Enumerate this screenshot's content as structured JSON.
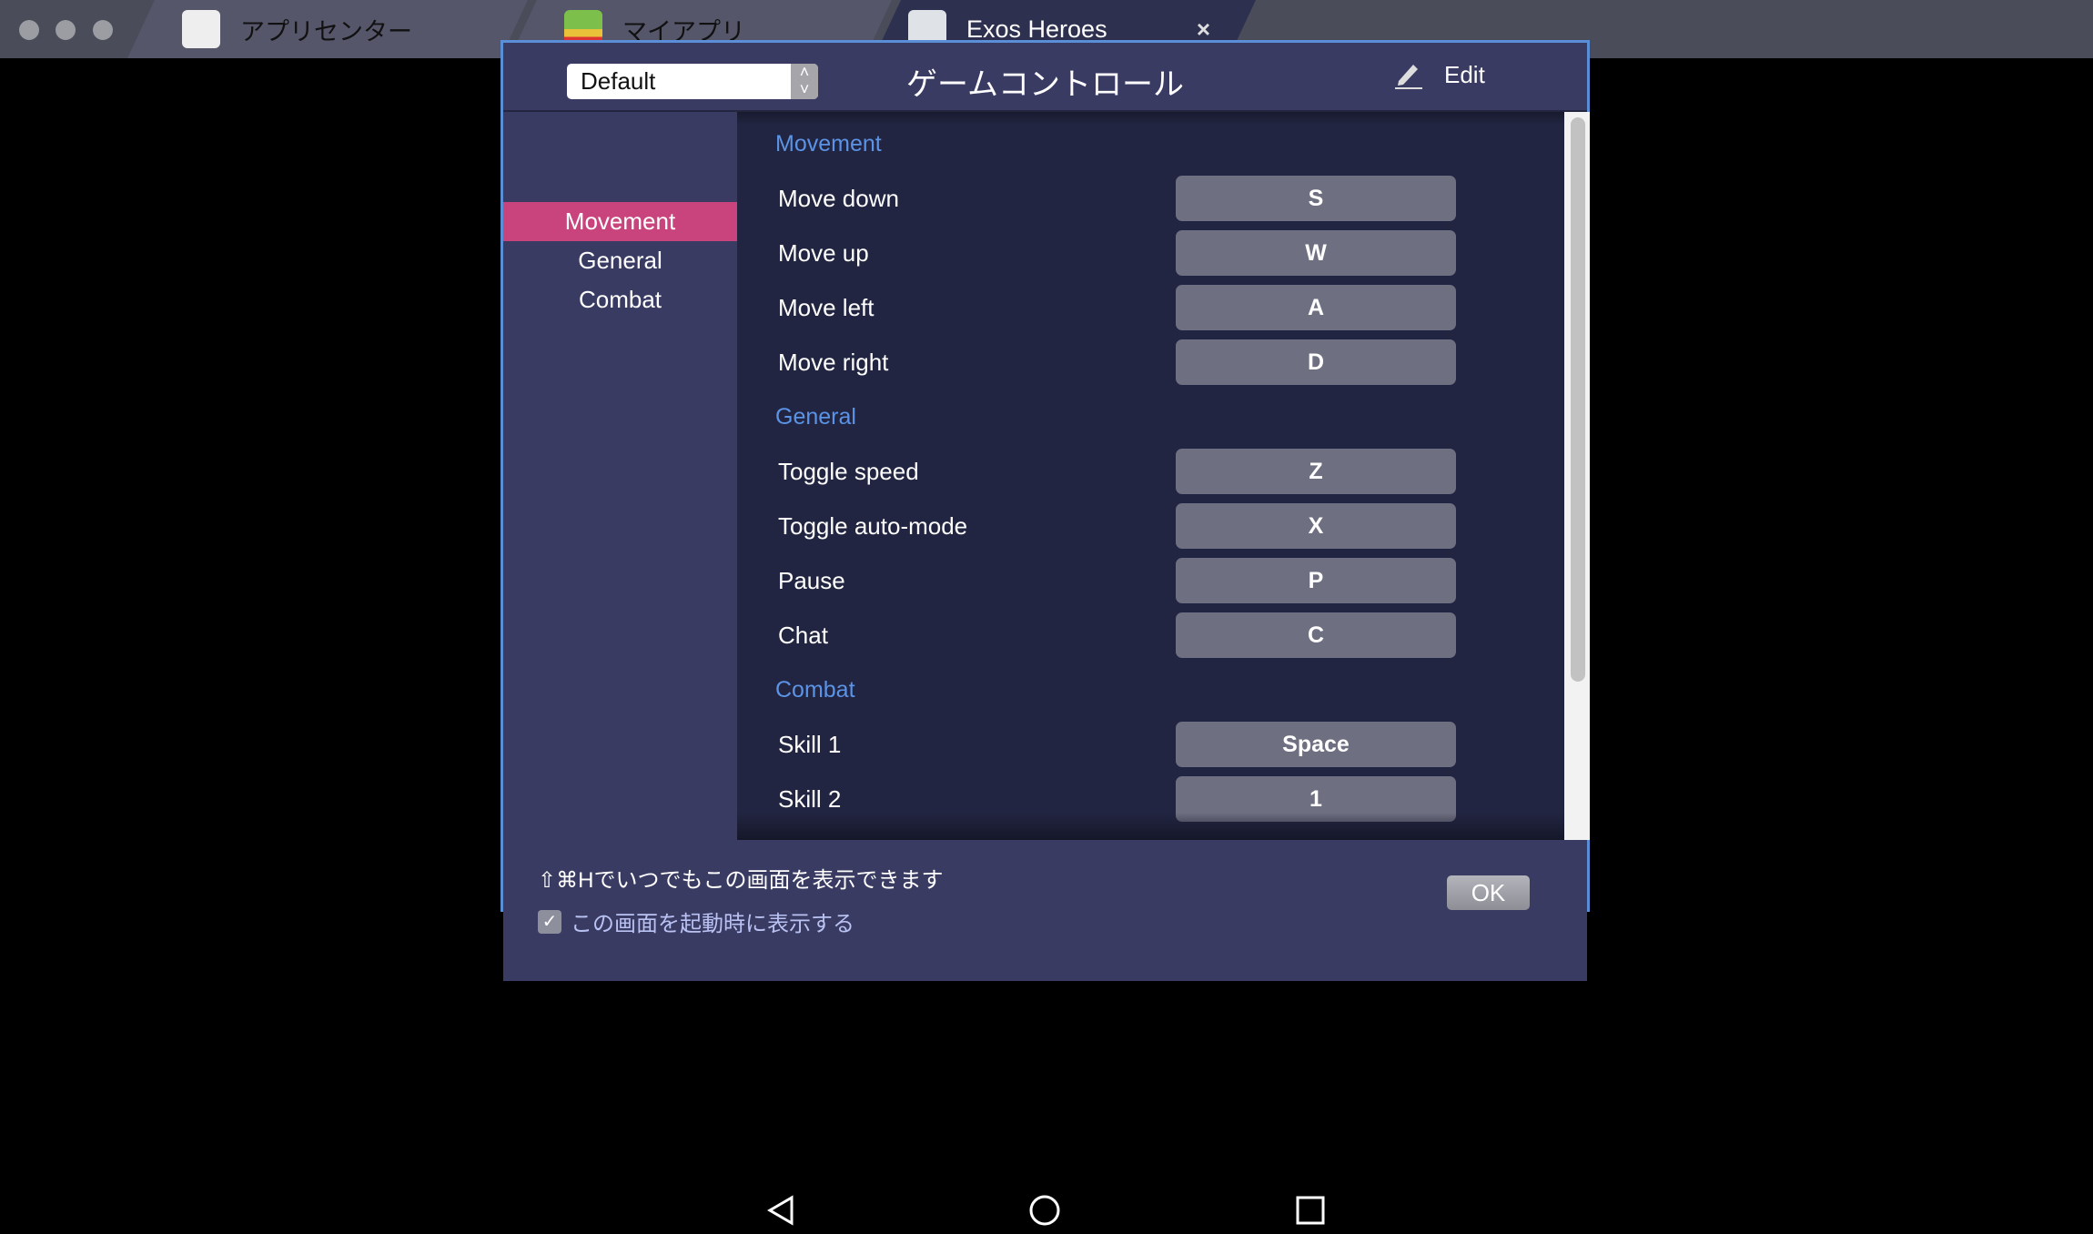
{
  "tabs": [
    {
      "label": "アプリセンター",
      "icon": "app-center-icon",
      "active": false
    },
    {
      "label": "マイアプリ",
      "icon": "my-apps-icon",
      "active": false
    },
    {
      "label": "Exos Heroes",
      "icon": "exos-heroes-icon",
      "active": true,
      "close": "×"
    }
  ],
  "dialog": {
    "profile": "Default",
    "title": "ゲームコントロール",
    "edit_label": "Edit",
    "sidebar": [
      {
        "label": "Movement",
        "active": true
      },
      {
        "label": "General",
        "active": false
      },
      {
        "label": "Combat",
        "active": false
      }
    ],
    "sections": [
      {
        "title": "Movement",
        "rows": [
          {
            "action": "Move down",
            "key": "S"
          },
          {
            "action": "Move up",
            "key": "W"
          },
          {
            "action": "Move left",
            "key": "A"
          },
          {
            "action": "Move right",
            "key": "D"
          }
        ]
      },
      {
        "title": "General",
        "rows": [
          {
            "action": "Toggle speed",
            "key": "Z"
          },
          {
            "action": "Toggle auto-mode",
            "key": "X"
          },
          {
            "action": "Pause",
            "key": "P"
          },
          {
            "action": "Chat",
            "key": "C"
          }
        ]
      },
      {
        "title": "Combat",
        "rows": [
          {
            "action": "Skill 1",
            "key": "Space"
          },
          {
            "action": "Skill 2",
            "key": "1"
          }
        ]
      }
    ],
    "footer": {
      "hint": "⇧⌘Hでいつでもこの画面を表示できます",
      "checkbox_label": "この画面を起動時に表示する",
      "checkbox_checked": true,
      "ok_label": "OK"
    }
  },
  "colors": {
    "accent": "#c9437d",
    "section": "#5b93e6",
    "border": "#5a8fd8"
  }
}
